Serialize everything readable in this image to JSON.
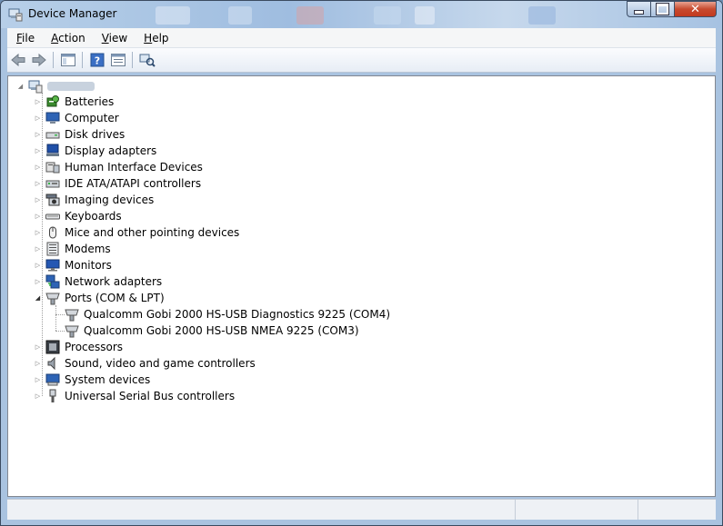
{
  "window": {
    "title": "Device Manager"
  },
  "menu": [
    {
      "label": "File"
    },
    {
      "label": "Action"
    },
    {
      "label": "View"
    },
    {
      "label": "Help"
    }
  ],
  "toolbar": [
    {
      "icon": "back-arrow-icon"
    },
    {
      "icon": "forward-arrow-icon"
    },
    {
      "icon": "show-hide-console-tree-icon"
    },
    {
      "icon": "help-icon"
    },
    {
      "icon": "properties-icon"
    },
    {
      "icon": "scan-hardware-icon"
    }
  ],
  "tree": {
    "root": {
      "label": "",
      "icon": "computer-root-icon",
      "expanded": true
    },
    "categories": [
      {
        "label": "Batteries",
        "icon": "battery-icon",
        "expanded": false
      },
      {
        "label": "Computer",
        "icon": "computer-icon",
        "expanded": false
      },
      {
        "label": "Disk drives",
        "icon": "disk-drive-icon",
        "expanded": false
      },
      {
        "label": "Display adapters",
        "icon": "display-adapter-icon",
        "expanded": false
      },
      {
        "label": "Human Interface Devices",
        "icon": "hid-icon",
        "expanded": false
      },
      {
        "label": "IDE ATA/ATAPI controllers",
        "icon": "ide-controller-icon",
        "expanded": false
      },
      {
        "label": "Imaging devices",
        "icon": "camera-icon",
        "expanded": false
      },
      {
        "label": "Keyboards",
        "icon": "keyboard-icon",
        "expanded": false
      },
      {
        "label": "Mice and other pointing devices",
        "icon": "mouse-icon",
        "expanded": false
      },
      {
        "label": "Modems",
        "icon": "modem-icon",
        "expanded": false
      },
      {
        "label": "Monitors",
        "icon": "monitor-icon",
        "expanded": false
      },
      {
        "label": "Network adapters",
        "icon": "network-adapter-icon",
        "expanded": false
      },
      {
        "label": "Ports (COM & LPT)",
        "icon": "port-icon",
        "expanded": true,
        "children": [
          {
            "label": "Qualcomm Gobi 2000 HS-USB Diagnostics 9225 (COM4)",
            "icon": "port-device-icon"
          },
          {
            "label": "Qualcomm Gobi 2000 HS-USB NMEA 9225 (COM3)",
            "icon": "port-device-icon"
          }
        ]
      },
      {
        "label": "Processors",
        "icon": "processor-icon",
        "expanded": false
      },
      {
        "label": "Sound, video and game controllers",
        "icon": "speaker-icon",
        "expanded": false
      },
      {
        "label": "System devices",
        "icon": "system-devices-icon",
        "expanded": false
      },
      {
        "label": "Universal Serial Bus controllers",
        "icon": "usb-icon",
        "expanded": false
      }
    ]
  },
  "colors": {
    "titlebar": "#a9c3e0",
    "close_button": "#c74a2f",
    "tree_text": "#000000"
  }
}
